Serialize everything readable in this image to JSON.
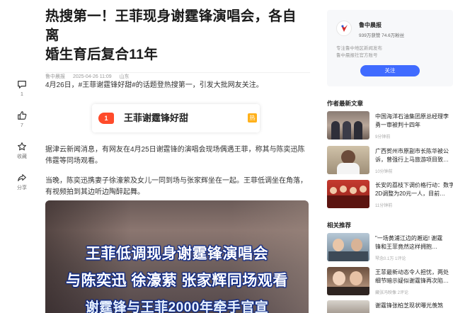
{
  "article": {
    "title_line1": "热搜第一！王菲现身谢霆锋演唱会，各自离",
    "title_line2": "婚生育后复合11年",
    "source": "鲁中晨报",
    "datetime": "2025-04-26 11:09",
    "location": "山东",
    "para1": "4月26日，#王菲谢霆锋好甜#的话题登热搜第一，引发大批网友关注。",
    "hot_rank": "1",
    "hot_topic": "王菲谢霆锋好甜",
    "hot_tag": "热",
    "para2": "据津云新闻消息，有网友在4月25日谢霆锋的演唱会现场偶遇王菲，称其与陈奕迅陈伟霆等同场观看。",
    "para3": "当晚，陈奕迅携妻子徐濠萦及女儿一同到场与张家辉坐在一起。王菲低调坐在角落，有视频拍到其边听边陶醉起舞。",
    "video_caption1": "王菲低调现身谢霆锋演唱会",
    "video_caption2": "与陈奕迅 徐濠萦 张家辉同场观看",
    "video_caption3": "谢霆锋与王菲2000年牵手官宣"
  },
  "rail": {
    "comment_count": "1",
    "like_count": "7",
    "favorite_label": "收藏",
    "share_label": "分享"
  },
  "profile": {
    "name": "鲁中晨报",
    "stats": "939万获赞 74.6万粉丝",
    "desc1": "专注鲁中地区新闻发布",
    "desc2": "鲁中晨报社官方账号",
    "follow_label": "关注"
  },
  "author_latest": {
    "heading": "作者最新文章",
    "items": [
      {
        "line1": "中国海洋石油集团原总经理李",
        "line2": "勇一审被判十四年",
        "meta": "9分钟前"
      },
      {
        "line1": "广西贺州市原副市长陈华被公",
        "line2": "诉，曾强行上马旅游项目致…",
        "meta": "10分钟前"
      },
      {
        "line1": "长安的荔枝下调价格行动：数字",
        "line2": "2D调整为20元一人，目前…",
        "meta": "11分钟前"
      }
    ]
  },
  "related": {
    "heading": "相关推荐",
    "items": [
      {
        "line1": "\"一场黄浦江边的邂逅! 谢霆",
        "line2": "锋和王菲竟然这样拥抱…",
        "meta": "琴念0.1万 1评论"
      },
      {
        "line1": "王菲最新动态令人担忧，两处",
        "line2": "细节暗示疑似谢霆锋再次陷…",
        "meta": "藏张冯映像 2评论"
      },
      {
        "line1": "谢霆锋张柏芝现状曝光羡煞",
        "line2": "",
        "meta": ""
      }
    ]
  }
}
